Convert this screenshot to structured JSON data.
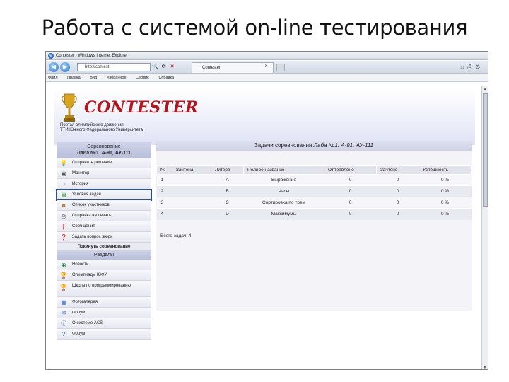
{
  "slide": {
    "title": "Работа с системой on-line тестирования"
  },
  "window": {
    "title": "Contester - Windows Internet Explorer"
  },
  "toolbar": {
    "address": "http://contest.",
    "tab_label": "Contester",
    "tab_close": "x"
  },
  "menu": [
    "Файл",
    "Правка",
    "Вид",
    "Избранное",
    "Сервис",
    "Справка"
  ],
  "site": {
    "logo": "CONTESTER",
    "portal_line1": "Портал олимпийского движения",
    "portal_line2": "ТТИ Южного Федерального Университета"
  },
  "sidebar": {
    "competition_label": "Соревнование",
    "competition_name": "Лаба №1. А-91, АУ-111",
    "items": [
      {
        "label": "Отправить решение",
        "icon": "lightbulb-icon"
      },
      {
        "label": "Монитор",
        "icon": "monitor-icon"
      },
      {
        "label": "История",
        "icon": "history-icon"
      },
      {
        "label": "Условия задач",
        "icon": "document-icon"
      },
      {
        "label": "Список участников",
        "icon": "users-icon"
      },
      {
        "label": "Отправка на печать",
        "icon": "printer-icon"
      },
      {
        "label": "Сообщения",
        "icon": "info-icon"
      },
      {
        "label": "Задать вопрос жюри",
        "icon": "question-icon"
      }
    ],
    "leave_label": "Покинуть соревнование",
    "sections_label": "Разделы",
    "section_items": [
      {
        "label": "Новости",
        "icon": "globe-icon"
      },
      {
        "label": "Олимпиады ЮФУ",
        "icon": "trophy-icon"
      },
      {
        "label": "Школа по программированию",
        "icon": "trophy-icon"
      },
      {
        "label": "Фотогалерея",
        "icon": "photo-icon"
      },
      {
        "label": "Форум",
        "icon": "forum-icon"
      },
      {
        "label": "О системе ACS",
        "icon": "info-icon"
      },
      {
        "label": "Форум",
        "icon": "question-icon"
      }
    ]
  },
  "problems": {
    "title_prefix": "Задачи соревнования",
    "title_name": "Лаба №1. А-91, АУ-111",
    "columns": [
      "№",
      "Зачтена",
      "Литера",
      "Полное название",
      "Отправлено",
      "Зачтено",
      "Успешность"
    ],
    "rows": [
      {
        "num": "1",
        "accepted": "",
        "letter": "A",
        "name": "Выражение",
        "sent": "0",
        "passed": "0",
        "success": "0 %"
      },
      {
        "num": "2",
        "accepted": "",
        "letter": "B",
        "name": "Часы",
        "sent": "0",
        "passed": "0",
        "success": "0 %"
      },
      {
        "num": "3",
        "accepted": "",
        "letter": "C",
        "name": "Сортировка по трем",
        "sent": "0",
        "passed": "0",
        "success": "0 %"
      },
      {
        "num": "4",
        "accepted": "",
        "letter": "D",
        "name": "Максимумы",
        "sent": "0",
        "passed": "0",
        "success": "0 %"
      }
    ],
    "total_label": "Всего задач:",
    "total_value": "4"
  }
}
